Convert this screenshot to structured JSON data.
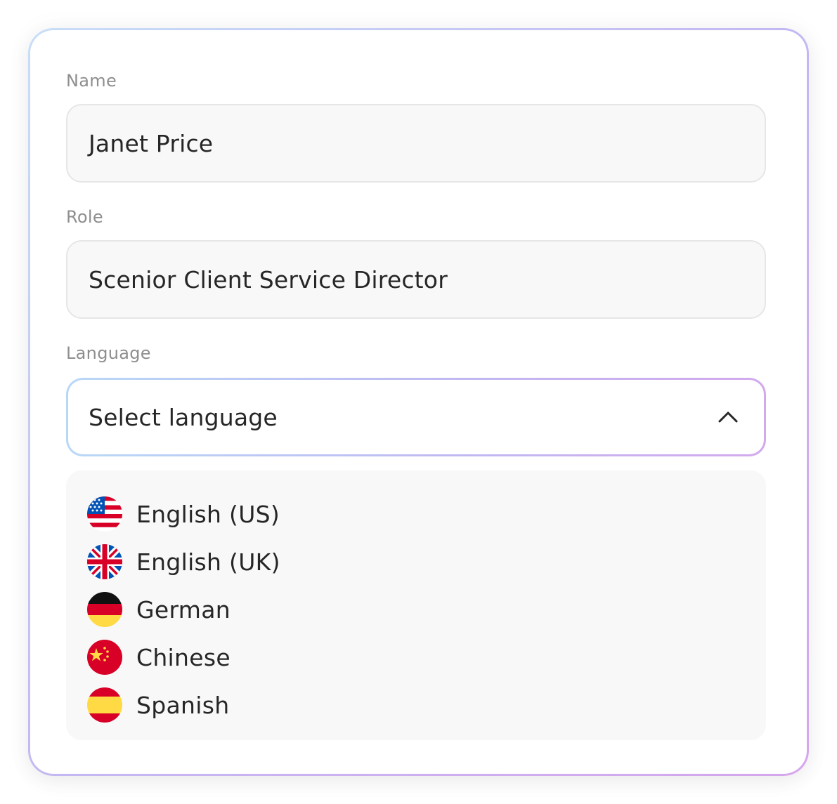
{
  "form": {
    "name": {
      "label": "Name",
      "value": "Janet Price"
    },
    "role": {
      "label": "Role",
      "value": "Scenior Client Service Director"
    },
    "language": {
      "label": "Language",
      "placeholder": "Select language",
      "state": "open",
      "chevron_icon": "chevron-up-icon",
      "options": [
        {
          "label": "English (US)",
          "icon": "us-flag-icon"
        },
        {
          "label": "English (UK)",
          "icon": "uk-flag-icon"
        },
        {
          "label": "German",
          "icon": "germany-flag-icon"
        },
        {
          "label": "Chinese",
          "icon": "china-flag-icon"
        },
        {
          "label": "Spanish",
          "icon": "spain-flag-icon"
        }
      ]
    }
  },
  "colors": {
    "text": "#262626",
    "label": "#8e8e8e",
    "field_bg": "#f8f8f8",
    "field_border": "#e6e6e6",
    "accent_gradient_start": "#b9d8f7",
    "accent_gradient_end": "#d3a9ee"
  }
}
